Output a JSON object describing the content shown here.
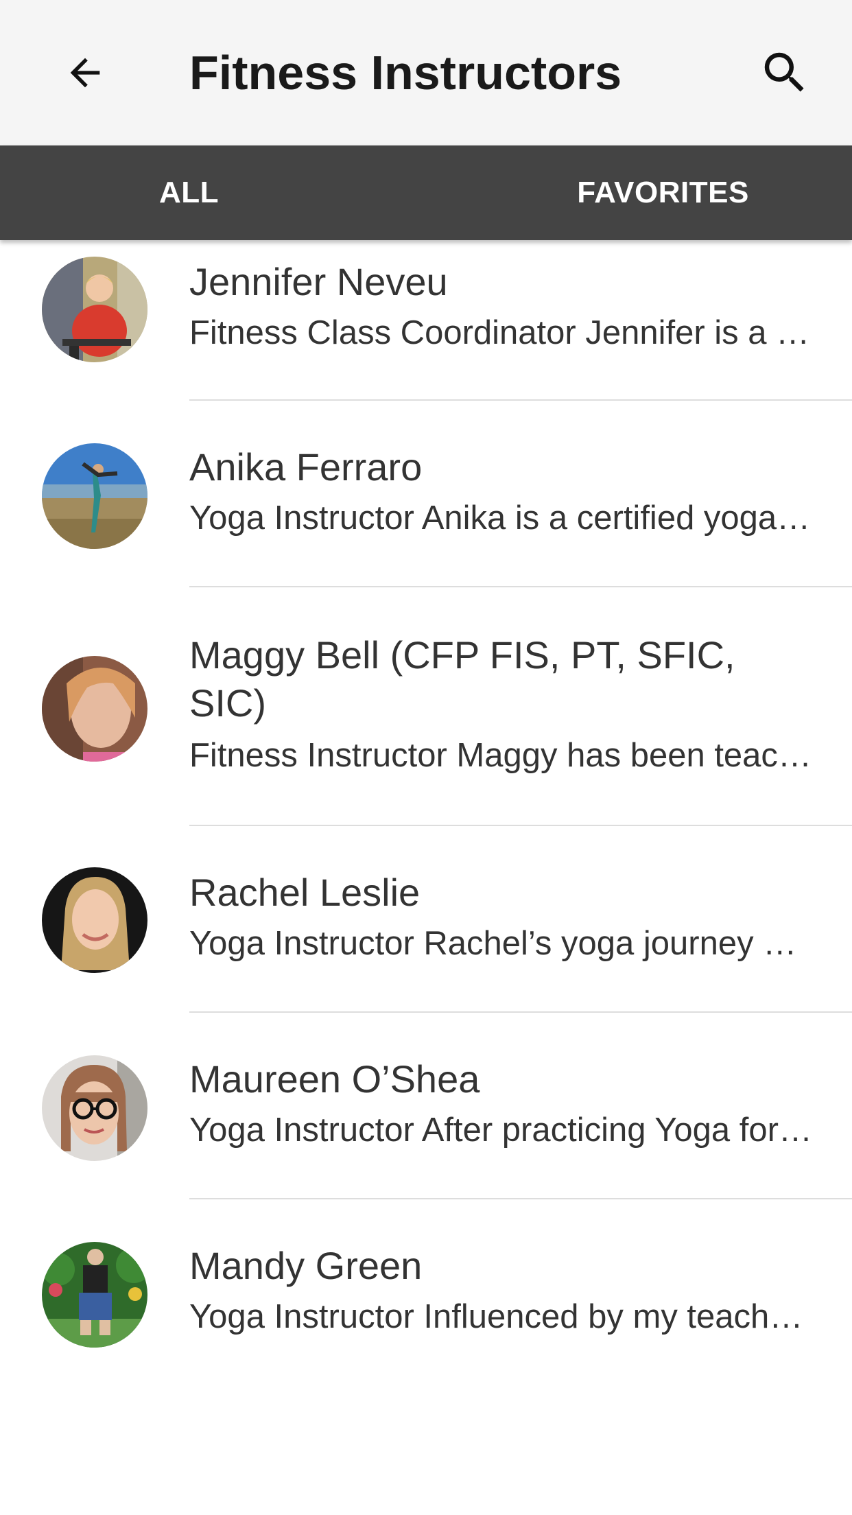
{
  "appbar": {
    "title": "Fitness Instructors",
    "back_icon": "arrow-left-icon",
    "search_icon": "search-icon"
  },
  "tabs": [
    {
      "label": "ALL"
    },
    {
      "label": "FAVORITES"
    }
  ],
  "instructors": [
    {
      "name": "Jennifer Neveu",
      "description": "Fitness Class Coordinator Jennifer is a dedicated fitness professional"
    },
    {
      "name": "Anika Ferraro",
      "description": "Yoga Instructor Anika is a certified yoga teacher"
    },
    {
      "name": "Maggy Bell (CFP FIS, PT, SFIC, SIC)",
      "description": "Fitness Instructor Maggy has been teaching for many years"
    },
    {
      "name": "Rachel Leslie",
      "description": "Yoga Instructor Rachel’s yoga journey began years ago"
    },
    {
      "name": "Maureen O’Shea",
      "description": "Yoga Instructor After practicing Yoga for many years"
    },
    {
      "name": "Mandy Green",
      "description": "Yoga Instructor Influenced by my teachers"
    }
  ],
  "colors": {
    "appbar_bg": "#f5f5f5",
    "tabbar_bg": "#444444",
    "text": "#333333"
  }
}
